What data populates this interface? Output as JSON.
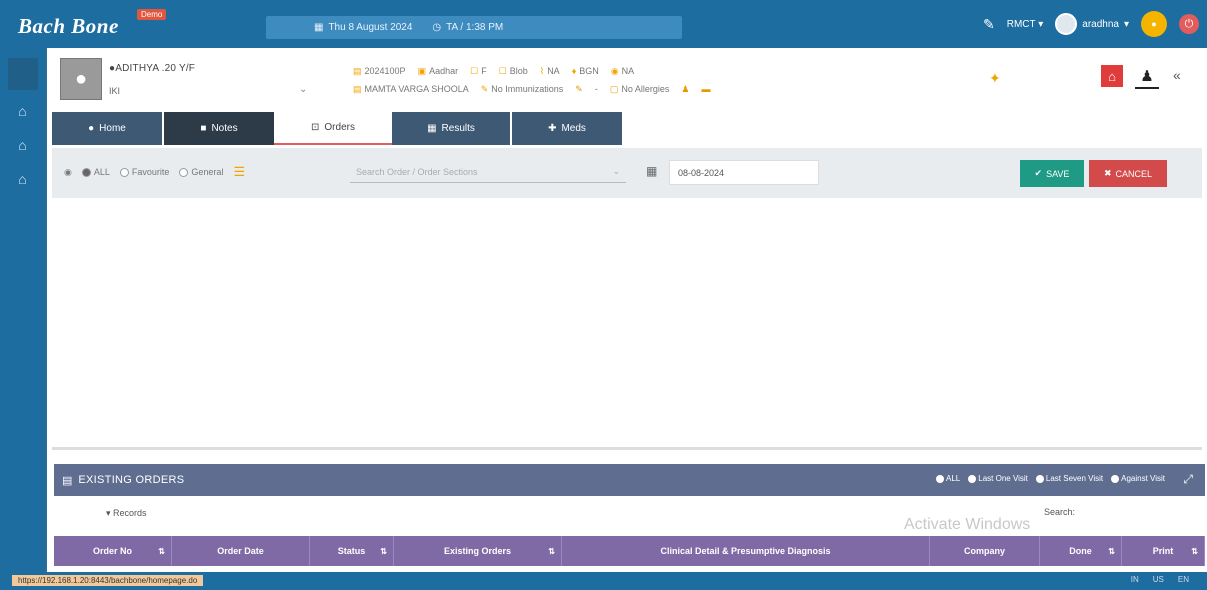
{
  "app": {
    "logo": "Bach Bone",
    "badge": "Demo"
  },
  "topbar": {
    "date": "Thu 8 August 2024",
    "time": "TA / 1:38 PM",
    "org": "RMCT",
    "user": "aradhna"
  },
  "patient": {
    "name": "●ADITHYA .20 Y/F",
    "sub": "IKI",
    "id": "2024100P",
    "phone": "Aadhar",
    "f1": "F",
    "f2": "Blob",
    "f3": "NA",
    "f4": "BGN",
    "f5": "NA",
    "doctor": "MAMTA VARGA SHOOLA",
    "immun": "No Immunizations",
    "dash": "-",
    "allergy": "No Allergies"
  },
  "tabs": [
    {
      "label": "Home",
      "icon": "●"
    },
    {
      "label": "Notes",
      "icon": "■"
    },
    {
      "label": "Orders",
      "icon": "⊡"
    },
    {
      "label": "Results",
      "icon": "▦"
    },
    {
      "label": "Meds",
      "icon": "✚"
    }
  ],
  "toolbar": {
    "opt_all": "ALL",
    "opt_favourite": "Favourite",
    "opt_general": "General",
    "search_placeholder": "Search Order / Order Sections",
    "date_value": "08-08-2024",
    "save_label": "SAVE",
    "cancel_label": "CANCEL"
  },
  "orders": {
    "title": "EXISTING ORDERS",
    "filters": [
      "ALL",
      "Last One Visit",
      "Last Seven Visit",
      "Against Visit"
    ],
    "records": "Records",
    "search": "Search:",
    "watermark": "Activate Windows",
    "columns": [
      "Order No",
      "Order Date",
      "Status",
      "Existing Orders",
      "Clinical Detail & Presumptive Diagnosis",
      "Company",
      "Done",
      "Print"
    ]
  },
  "statusbar": {
    "url": "https://192.168.1.20:8443/bachbone/homepage.do",
    "right": [
      "IN",
      "US",
      "EN"
    ]
  },
  "colors": {
    "primary": "#1d6da1",
    "tab_dark": "#3d5973",
    "save": "#1f9a84",
    "cancel": "#d24a4a",
    "orders_header": "#5f6e90",
    "table_header": "#7f6aa6"
  }
}
